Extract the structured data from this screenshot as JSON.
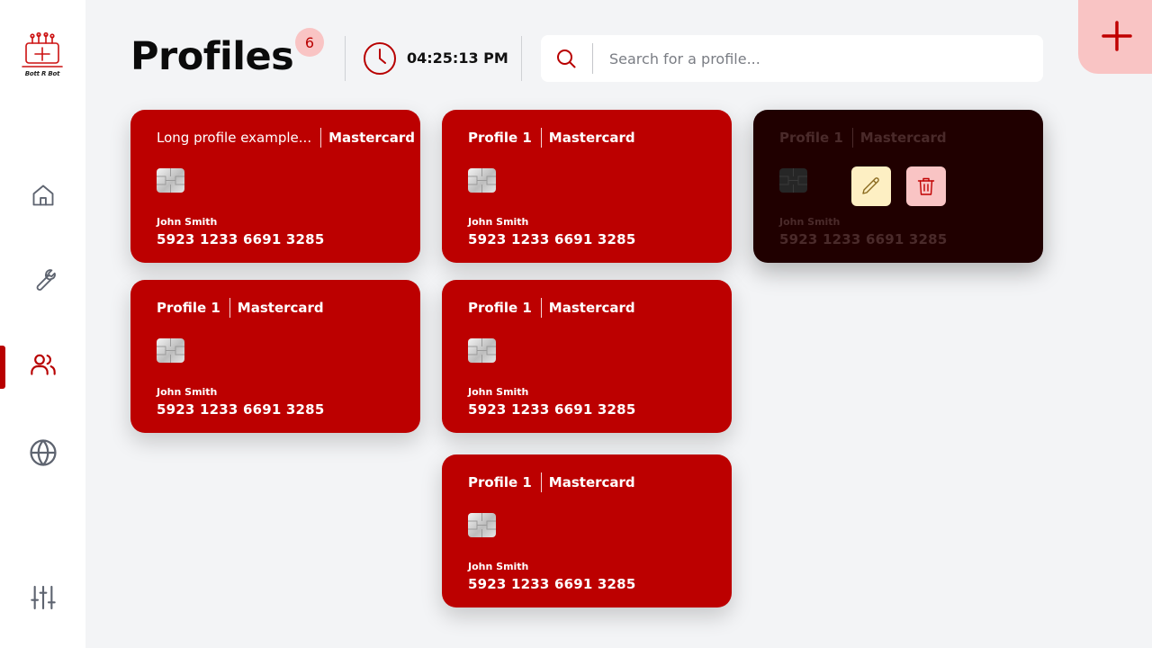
{
  "app": {
    "logo_text": "Bott R Bot"
  },
  "sidebar": {
    "items": [
      {
        "name": "home",
        "icon": "home-icon",
        "active": false
      },
      {
        "name": "tools",
        "icon": "wrench-icon",
        "active": false
      },
      {
        "name": "profiles",
        "icon": "users-icon",
        "active": true
      },
      {
        "name": "proxies",
        "icon": "globe-icon",
        "active": false
      },
      {
        "name": "settings",
        "icon": "sliders-icon",
        "active": false
      }
    ]
  },
  "header": {
    "title": "Profiles",
    "count": "6",
    "time": "04:25:13 PM",
    "search_placeholder": "Search for a profile...",
    "add_icon": "plus-icon"
  },
  "colors": {
    "accent": "#b80000",
    "card": "#bc0000",
    "card_selected": "#200000",
    "badge_bg": "#f9c4c4",
    "edit_bg": "#fdefc3",
    "delete_bg": "#f9c4c4",
    "background": "#f3f4f6"
  },
  "cards": [
    {
      "name": "Long profile example...",
      "type": "Mastercard",
      "holder": "John Smith",
      "number": "5923 1233 6691 3285"
    },
    {
      "name": "Profile 1",
      "type": "Mastercard",
      "holder": "John Smith",
      "number": "5923 1233 6691 3285"
    },
    {
      "name": "Profile 1",
      "type": "Mastercard",
      "holder": "John Smith",
      "number": "5923 1233 6691 3285",
      "selected": true
    },
    {
      "name": "Profile 1",
      "type": "Mastercard",
      "holder": "John Smith",
      "number": "5923 1233 6691 3285"
    },
    {
      "name": "Profile 1",
      "type": "Mastercard",
      "holder": "John Smith",
      "number": "5923 1233 6691 3285"
    },
    {
      "name": "Profile 1",
      "type": "Mastercard",
      "holder": "John Smith",
      "number": "5923 1233 6691 3285"
    }
  ]
}
